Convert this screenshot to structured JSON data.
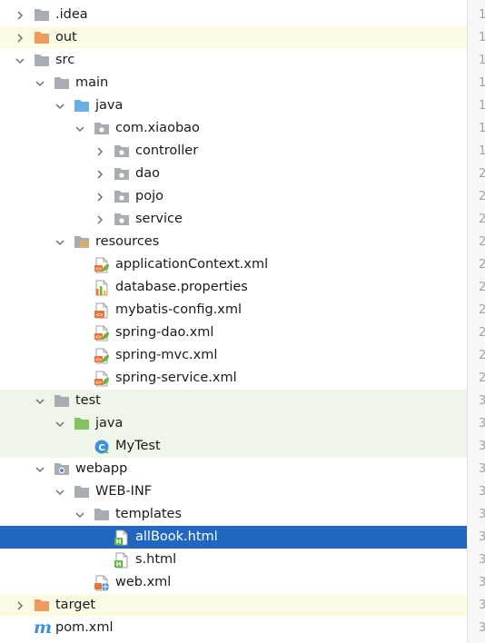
{
  "project_tree": {
    "rows": [
      {
        "label": ".idea",
        "icon": "folder-icon",
        "expanded": false,
        "depth": 0
      },
      {
        "label": "out",
        "icon": "orange-folder-icon",
        "expanded": false,
        "depth": 0
      },
      {
        "label": "src",
        "icon": "folder-icon",
        "expanded": true,
        "depth": 0
      },
      {
        "label": "main",
        "icon": "folder-icon",
        "expanded": true,
        "depth": 1
      },
      {
        "label": "java",
        "icon": "source-folder-icon",
        "expanded": true,
        "depth": 2
      },
      {
        "label": "com.xiaobao",
        "icon": "package-icon",
        "expanded": true,
        "depth": 3
      },
      {
        "label": "controller",
        "icon": "package-icon",
        "expanded": false,
        "depth": 4
      },
      {
        "label": "dao",
        "icon": "package-icon",
        "expanded": false,
        "depth": 4
      },
      {
        "label": "pojo",
        "icon": "package-icon",
        "expanded": false,
        "depth": 4
      },
      {
        "label": "service",
        "icon": "package-icon",
        "expanded": false,
        "depth": 4
      },
      {
        "label": "resources",
        "icon": "resources-folder-icon",
        "expanded": true,
        "depth": 2
      },
      {
        "label": "applicationContext.xml",
        "icon": "spring-xml-icon",
        "depth": 3
      },
      {
        "label": "database.properties",
        "icon": "properties-file-icon",
        "depth": 3
      },
      {
        "label": "mybatis-config.xml",
        "icon": "xml-file-icon",
        "depth": 3
      },
      {
        "label": "spring-dao.xml",
        "icon": "spring-xml-icon",
        "depth": 3
      },
      {
        "label": "spring-mvc.xml",
        "icon": "spring-xml-icon",
        "depth": 3
      },
      {
        "label": "spring-service.xml",
        "icon": "spring-xml-icon",
        "depth": 3
      },
      {
        "label": "test",
        "icon": "folder-icon",
        "expanded": true,
        "depth": 1
      },
      {
        "label": "java",
        "icon": "test-source-folder-icon",
        "expanded": true,
        "depth": 2
      },
      {
        "label": "MyTest",
        "icon": "java-class-icon",
        "depth": 3
      },
      {
        "label": "webapp",
        "icon": "web-folder-icon",
        "expanded": true,
        "depth": 1
      },
      {
        "label": "WEB-INF",
        "icon": "folder-icon",
        "expanded": true,
        "depth": 2
      },
      {
        "label": "templates",
        "icon": "folder-icon",
        "expanded": true,
        "depth": 3
      },
      {
        "label": "allBook.html",
        "icon": "html-file-icon",
        "depth": 4,
        "selected": true
      },
      {
        "label": "s.html",
        "icon": "html-file-icon",
        "depth": 4
      },
      {
        "label": "web.xml",
        "icon": "web-xml-icon",
        "depth": 3
      },
      {
        "label": "target",
        "icon": "orange-folder-icon",
        "expanded": false,
        "depth": 0
      },
      {
        "label": "pom.xml",
        "icon": "maven-icon",
        "depth": 0
      }
    ]
  },
  "gutter": {
    "line_numbers": [
      "1",
      "1",
      "1",
      "1",
      "1",
      "1",
      "1",
      "2",
      "2",
      "2",
      "2",
      "2",
      "2",
      "2",
      "2",
      "2",
      "2",
      "3",
      "3",
      "3",
      "3",
      "3",
      "3",
      "3",
      "3",
      "3",
      "3",
      "3"
    ]
  },
  "colors": {
    "selection": "#2167c1",
    "excluded_row": "#fefbe5",
    "test_row": "#eff6e9",
    "folder": "#a8adb3",
    "orange_folder": "#ee9b5f",
    "source_folder": "#6aaee6",
    "test_folder": "#84c25f"
  }
}
